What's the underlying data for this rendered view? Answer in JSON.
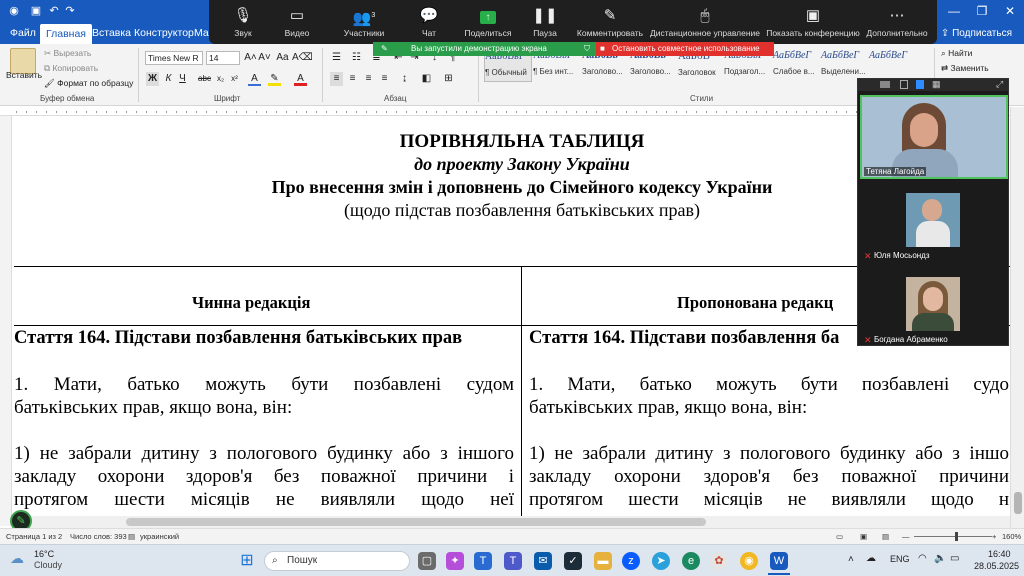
{
  "titlebar": {
    "right_label": "Подписаться"
  },
  "tabs": [
    {
      "label": "Файл"
    },
    {
      "label": "Главная"
    },
    {
      "label": "Вставка"
    },
    {
      "label": "Конструктор"
    },
    {
      "label": "Мак"
    }
  ],
  "share_label": "Поделиться",
  "ribbon": {
    "paste_label": "Вставить",
    "cut_label": "Вырезать",
    "copy_label": "Копировать",
    "format_painter_label": "Формат по образцу",
    "clipboard_group": "Буфер обмена",
    "font_name": "Times New R",
    "font_size": "14",
    "font_group": "Шрифт",
    "paragraph_group": "Абзац",
    "styles_group": "Стили",
    "styles": [
      {
        "sample": "АаБбВвГ",
        "name": "¶ Обычный"
      },
      {
        "sample": "АаБбВвГ",
        "name": "¶ Без инт..."
      },
      {
        "sample": "АаБбВв",
        "name": "Заголово..."
      },
      {
        "sample": "АаБбВв",
        "name": "Заголово..."
      },
      {
        "sample": "АаБбВ",
        "name": "Заголовок"
      },
      {
        "sample": "АаБбВвГ",
        "name": "Подзагол..."
      },
      {
        "sample": "АаБбВеГ",
        "name": "Слабое в..."
      },
      {
        "sample": "АаБбВеГ",
        "name": "Выделени..."
      },
      {
        "sample": "АаБбВеГ",
        "name": ""
      }
    ],
    "find_label": "Найти",
    "replace_label": "Заменить"
  },
  "zoom": {
    "items": [
      {
        "label": "Звук",
        "icon": "microphone-icon"
      },
      {
        "label": "Видео",
        "icon": "video-icon"
      },
      {
        "label": "Участники",
        "icon": "participants-icon",
        "count": "3"
      },
      {
        "label": "Чат",
        "icon": "chat-icon"
      },
      {
        "label": "Поделиться",
        "icon": "share-screen-icon"
      },
      {
        "label": "Пауза",
        "icon": "pause-icon"
      },
      {
        "label": "Комментировать",
        "icon": "annotate-icon"
      },
      {
        "label": "Дистанционное управление",
        "icon": "remote-control-icon"
      },
      {
        "label": "Показать конференцию",
        "icon": "show-meeting-icon"
      },
      {
        "label": "Дополнительно",
        "icon": "more-icon"
      }
    ],
    "share_banner": "Вы запустили демонстрацию экрана",
    "stop_banner": "Остановить совместное использование",
    "participants": [
      {
        "name": "Тетяна Лагойда"
      },
      {
        "name": "Юля Мосьондз"
      },
      {
        "name": "Богдана Абраменко"
      }
    ]
  },
  "document": {
    "title": "ПОРІВНЯЛЬНА ТАБЛИЦЯ",
    "subtitle": "до проекту Закону України",
    "heading": "Про внесення змін і доповнень до Сімейного кодексу України",
    "note": "(щодо підстав позбавлення батьківських прав)",
    "col_left_header": "Чинна редакція",
    "col_right_header": "Пропонована редакц",
    "left_article": "Стаття 164. Підстави позбавлення батьківських прав",
    "right_article": "Стаття 164. Підстави позбавлення ба",
    "left_p1_l1": "1. Мати, батько можуть бути позбавлені судом",
    "left_p1_l2": "батьківських прав, якщо вона, він:",
    "left_p2_l1": "1) не забрали дитину з пологового будинку або з іншого",
    "left_p2_l2": "закладу охорони здоров'я без поважної причини і",
    "left_p2_l3": "протягом шести місяців не виявляли щодо неї",
    "right_p1_l1": "1. Мати, батько можуть бути позбавлені судо",
    "right_p1_l2": "батьківських прав, якщо вона, він:",
    "right_p2_l1": "1) не забрали дитину з пологового будинку або з іншо",
    "right_p2_l2": "закладу охорони здоров'я без поважної причини",
    "right_p2_l3": "протягом шести місяців не виявляли щодо н"
  },
  "status": {
    "page": "Страница 1 из 2",
    "words": "Число слов: 393",
    "language": "украинский",
    "zoom": "160%"
  },
  "taskbar": {
    "weather_temp": "16°C",
    "weather_desc": "Cloudy",
    "search_placeholder": "Пошук",
    "lang": "ENG",
    "time": "16:40",
    "date": "28.05.2025"
  },
  "colors": {
    "word_blue": "#185abd",
    "zoom_dark": "#1f1f1f",
    "share_green": "#2a9d4a",
    "stop_red": "#e0312d",
    "active_speaker": "#4fc35c"
  }
}
